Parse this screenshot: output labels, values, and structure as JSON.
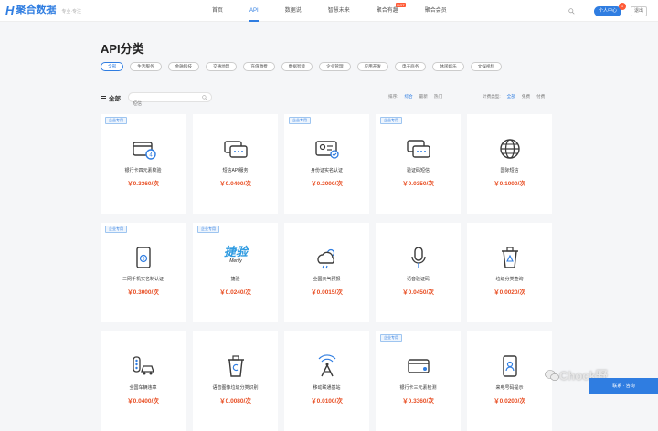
{
  "header": {
    "logo_mark": "H",
    "logo_text": "聚合数据",
    "slogan": "专业·专注",
    "nav": [
      {
        "label": "首页",
        "active": false,
        "badge": ""
      },
      {
        "label": "API",
        "active": true,
        "badge": ""
      },
      {
        "label": "数据说",
        "active": false,
        "badge": ""
      },
      {
        "label": "智慧未来",
        "active": false,
        "badge": ""
      },
      {
        "label": "聚合有趣",
        "active": false,
        "badge": "HOT"
      },
      {
        "label": "聚合会员",
        "active": false,
        "badge": ""
      }
    ],
    "console_label": "个人中心",
    "console_count": "1",
    "logout_label": "退出"
  },
  "page_title": "API分类",
  "categories": [
    {
      "label": "全部",
      "active": true
    },
    {
      "label": "生活服务",
      "active": false
    },
    {
      "label": "金融科技",
      "active": false
    },
    {
      "label": "交通地理",
      "active": false
    },
    {
      "label": "充值缴费",
      "active": false
    },
    {
      "label": "数据智能",
      "active": false
    },
    {
      "label": "企业管理",
      "active": false
    },
    {
      "label": "应用开发",
      "active": false
    },
    {
      "label": "电子商务",
      "active": false
    },
    {
      "label": "休闲娱乐",
      "active": false
    },
    {
      "label": "文娱视频",
      "active": false
    }
  ],
  "filter": {
    "all_label": "全部",
    "search_placeholder": "短信",
    "sort_label": "排序:",
    "sort_options": [
      {
        "label": "综合",
        "active": true
      },
      {
        "label": "最新",
        "active": false
      },
      {
        "label": "热门",
        "active": false
      }
    ],
    "billing_label": "计费类型:",
    "billing_options": [
      {
        "label": "全部",
        "active": true
      },
      {
        "label": "免费",
        "active": false
      },
      {
        "label": "付费",
        "active": false
      }
    ]
  },
  "cards": [
    {
      "name": "银行卡四元素校验",
      "price": "￥0.3360/次",
      "tag": "企业专用",
      "icon": "bank-card-verify-icon"
    },
    {
      "name": "短信API服务",
      "price": "￥0.0400/次",
      "tag": "",
      "icon": "sms-bubble-icon"
    },
    {
      "name": "身份证实名认证",
      "price": "￥0.2000/次",
      "tag": "企业专用",
      "icon": "id-card-icon"
    },
    {
      "name": "验证码短信",
      "price": "￥0.0350/次",
      "tag": "企业专用",
      "icon": "verify-sms-icon"
    },
    {
      "name": "国际短信",
      "price": "￥0.1000/次",
      "tag": "",
      "icon": "globe-icon"
    },
    {
      "name": "三网手机实名制认证",
      "price": "￥0.3000/次",
      "tag": "企业专用",
      "icon": "phone-verify-icon"
    },
    {
      "name": "捷验",
      "price": "￥0.0240/次",
      "tag": "企业专用",
      "icon": "jieyan-logo",
      "logo_text": "捷验",
      "logo_sub": "Merify"
    },
    {
      "name": "全国天气预报",
      "price": "￥0.0015/次",
      "tag": "",
      "icon": "weather-icon"
    },
    {
      "name": "语音验证码",
      "price": "￥0.0450/次",
      "tag": "",
      "icon": "microphone-icon"
    },
    {
      "name": "垃圾分类查询",
      "price": "￥0.0020/次",
      "tag": "",
      "icon": "recycle-bin-icon"
    },
    {
      "name": "全国车辆违章",
      "price": "￥0.0400/次",
      "tag": "",
      "icon": "traffic-car-icon"
    },
    {
      "name": "语音图像垃圾分类识别",
      "price": "￥0.0080/次",
      "tag": "",
      "icon": "garbage-recognize-icon"
    },
    {
      "name": "移动联通基站",
      "price": "￥0.0100/次",
      "tag": "",
      "icon": "signal-tower-icon"
    },
    {
      "name": "银行卡三元素检测",
      "price": "￥0.3360/次",
      "tag": "企业专用",
      "icon": "bank-card-icon"
    },
    {
      "name": "来电号码提示",
      "price": "￥0.0200/次",
      "tag": "",
      "icon": "caller-id-icon"
    }
  ],
  "watermark": "Chock野",
  "contact_label": "联系 · 咨询",
  "colors": {
    "accent": "#2f7de1",
    "price": "#e84d22",
    "badge": "#ff5a36"
  }
}
